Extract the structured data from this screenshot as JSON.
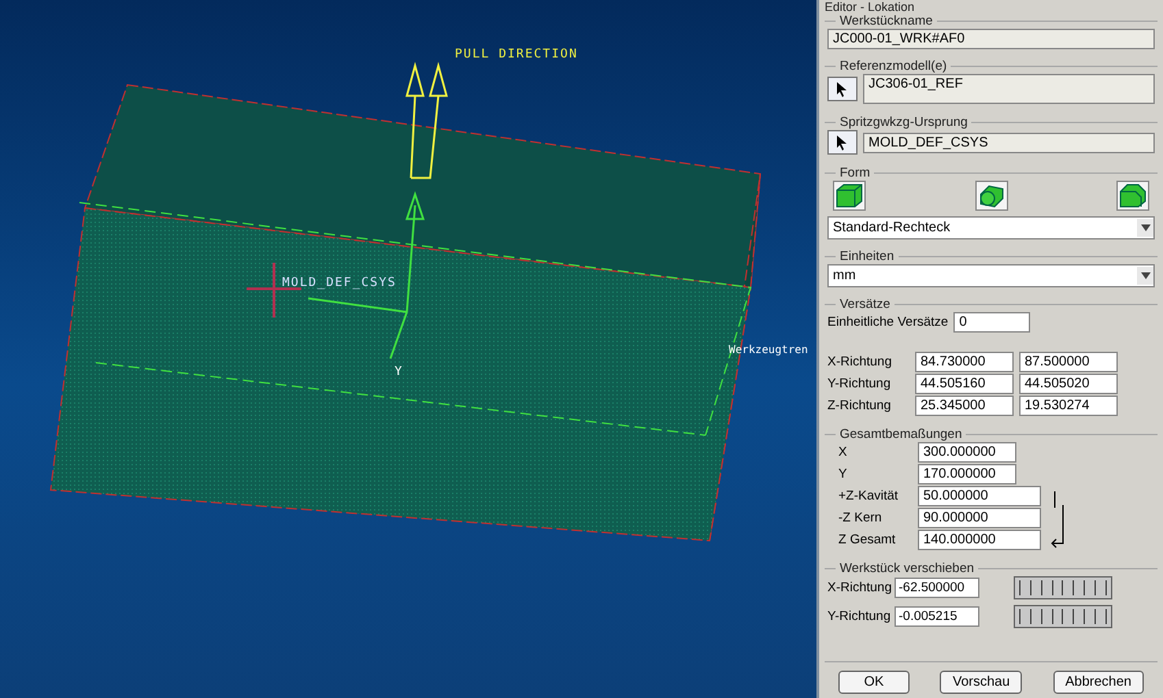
{
  "viewport": {
    "labels": [
      {
        "kind": "pull",
        "text": "PULL DIRECTION"
      },
      {
        "kind": "csys",
        "text": "MOLD_DEF_CSYS"
      },
      {
        "kind": "axis",
        "text": "Y"
      },
      {
        "kind": "edge",
        "text": "Werkzeugtren"
      }
    ]
  },
  "panel": {
    "title": "Editor - Lokation",
    "workpiece_name": {
      "label": "Werkstückname",
      "value": "JC000-01_WRK#AF0"
    },
    "reference_model": {
      "label": "Referenzmodell(e)",
      "value": "JC306-01_REF"
    },
    "origin": {
      "label": "Spritzgwkzg-Ursprung",
      "value": "MOLD_DEF_CSYS"
    },
    "shape": {
      "label": "Form",
      "options": [
        {
          "kind": "box"
        },
        {
          "kind": "cylinder"
        },
        {
          "kind": "custom"
        }
      ],
      "value": "Standard-Rechteck"
    },
    "units": {
      "label": "Einheiten",
      "value": "mm"
    },
    "offsets": {
      "label": "Versätze",
      "uniform_label": "Einheitliche Versätze",
      "uniform_value": "0",
      "rows": [
        {
          "label": "X-Richtung",
          "values": [
            "84.730000",
            "87.500000"
          ]
        },
        {
          "label": "Y-Richtung",
          "values": [
            "44.505160",
            "44.505020"
          ]
        },
        {
          "label": "Z-Richtung",
          "values": [
            "25.345000",
            "19.530274"
          ]
        }
      ]
    },
    "overall": {
      "label": "Gesamtbemaßungen",
      "rows": [
        {
          "label": "X",
          "value": "300.000000"
        },
        {
          "label": "Y",
          "value": "170.000000"
        },
        {
          "label": "+Z-Kavität",
          "value": "50.000000"
        },
        {
          "label": "-Z Kern",
          "value": "90.000000"
        },
        {
          "label": "Z Gesamt",
          "value": "140.000000"
        }
      ]
    },
    "move": {
      "label": "Werkstück verschieben",
      "rows": [
        {
          "label": "X-Richtung",
          "value": "-62.500000"
        },
        {
          "label": "Y-Richtung",
          "value": "-0.005215"
        }
      ]
    },
    "buttons": [
      "OK",
      "Vorschau",
      "Abbrechen"
    ]
  }
}
